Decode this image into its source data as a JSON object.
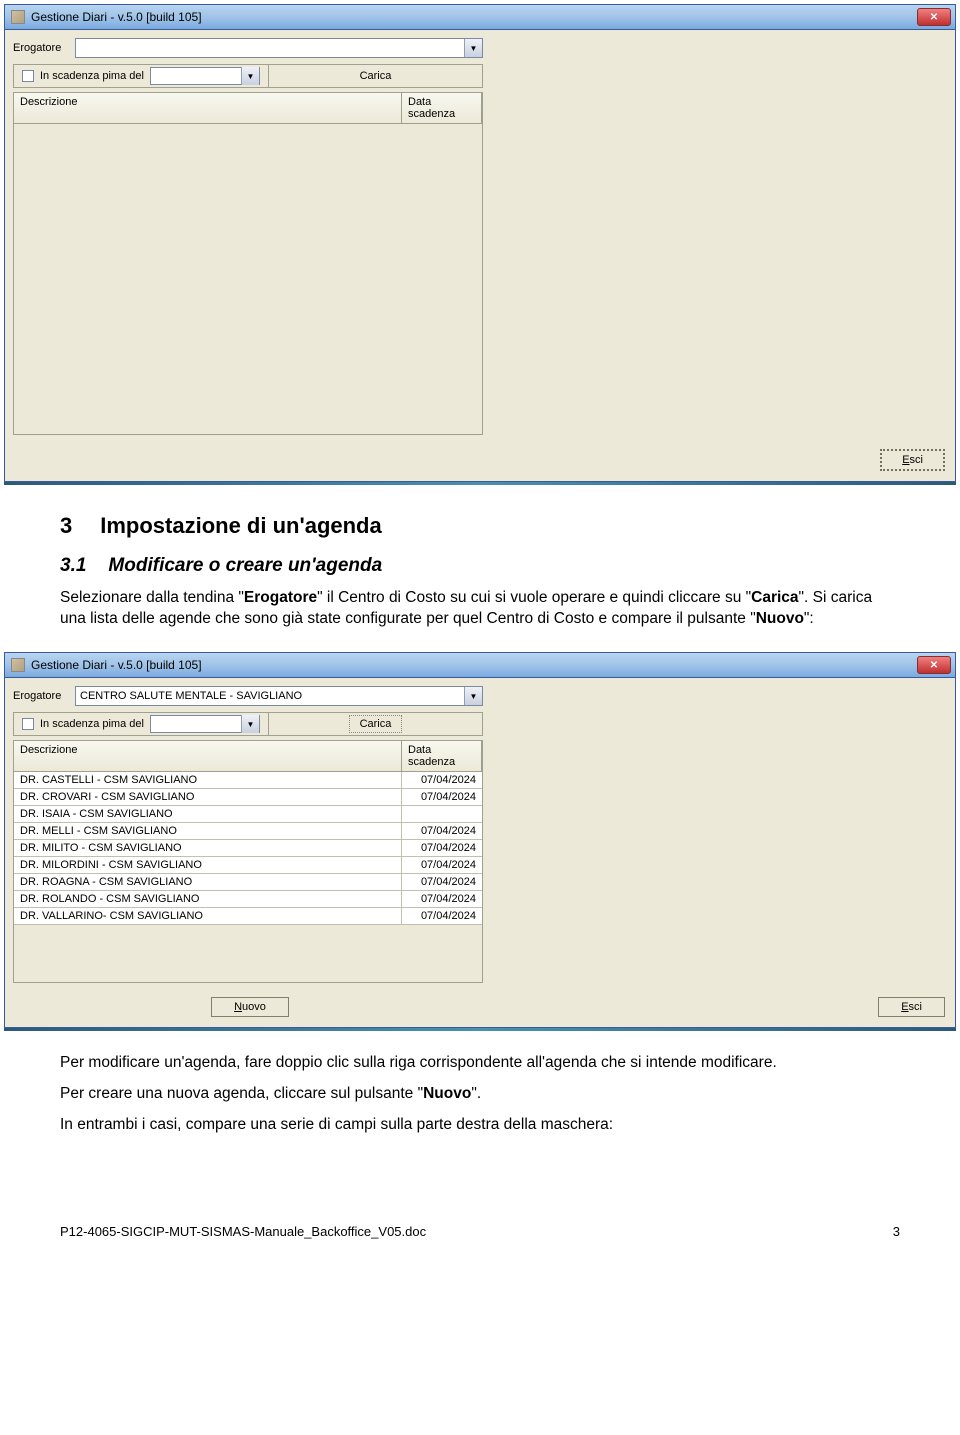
{
  "window1": {
    "title": "Gestione Diari - v.5.0 [build 105]",
    "erogatore_label": "Erogatore",
    "erogatore_value": "",
    "scadenza_label": "In scadenza pima del",
    "carica_label": "Carica",
    "col_desc": "Descrizione",
    "col_date": "Data scadenza",
    "esci_label": "Esci",
    "esci_mnemonic": "E"
  },
  "section": {
    "num": "3",
    "title": "Impostazione di un'agenda",
    "sub_num": "3.1",
    "sub_title": "Modificare o creare un'agenda",
    "para1a": "Selezionare dalla tendina \"",
    "para1b": "Erogatore",
    "para1c": "\" il Centro di Costo su cui si vuole operare e quindi cliccare su \"",
    "para1d": "Carica",
    "para1e": "\". Si carica una lista delle agende che sono già state configurate per quel Centro di Costo e compare il pulsante \"",
    "para1f": "Nuovo",
    "para1g": "\":",
    "para2": "Per modificare un'agenda, fare doppio clic sulla riga corrispondente all'agenda che si intende modificare.",
    "para3a": "Per creare una nuova agenda, cliccare sul pulsante \"",
    "para3b": "Nuovo",
    "para3c": "\".",
    "para4": "In entrambi i casi, compare una serie di campi sulla parte destra della maschera:"
  },
  "window2": {
    "title": "Gestione Diari - v.5.0 [build 105]",
    "erogatore_label": "Erogatore",
    "erogatore_value": "CENTRO SALUTE MENTALE - SAVIGLIANO",
    "scadenza_label": "In scadenza pima del",
    "carica_label": "Carica",
    "col_desc": "Descrizione",
    "col_date": "Data scadenza",
    "nuovo_label": "Nuovo",
    "nuovo_mnemonic": "N",
    "esci_label": "Esci",
    "esci_mnemonic": "E",
    "rows": [
      {
        "desc": "DR. CASTELLI - CSM SAVIGLIANO",
        "date": "07/04/2024"
      },
      {
        "desc": "DR. CROVARI - CSM SAVIGLIANO",
        "date": "07/04/2024"
      },
      {
        "desc": "DR. ISAIA - CSM SAVIGLIANO",
        "date": ""
      },
      {
        "desc": "DR. MELLI - CSM SAVIGLIANO",
        "date": "07/04/2024"
      },
      {
        "desc": "DR. MILITO - CSM SAVIGLIANO",
        "date": "07/04/2024"
      },
      {
        "desc": "DR. MILORDINI - CSM SAVIGLIANO",
        "date": "07/04/2024"
      },
      {
        "desc": "DR. ROAGNA - CSM SAVIGLIANO",
        "date": "07/04/2024"
      },
      {
        "desc": "DR. ROLANDO - CSM SAVIGLIANO",
        "date": "07/04/2024"
      },
      {
        "desc": "DR. VALLARINO- CSM SAVIGLIANO",
        "date": "07/04/2024"
      }
    ]
  },
  "footer": {
    "doc": "P12-4065-SIGCIP-MUT-SISMAS-Manuale_Backoffice_V05.doc",
    "page": "3"
  }
}
